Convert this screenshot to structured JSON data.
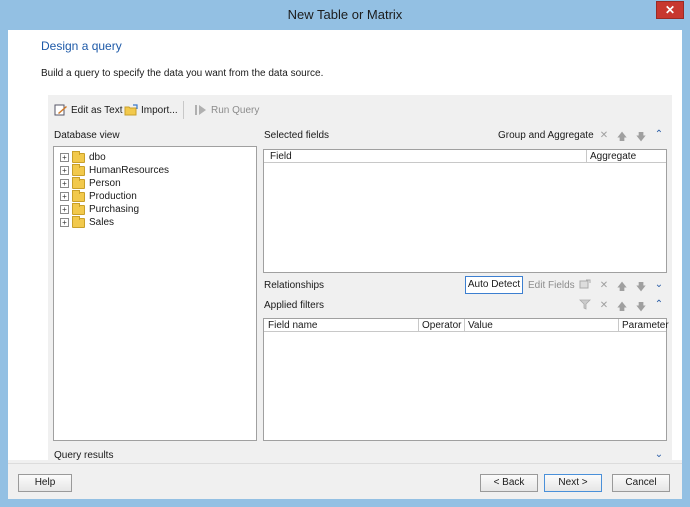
{
  "window": {
    "title": "New Table or Matrix",
    "close_glyph": "✕"
  },
  "page": {
    "title": "Design a query",
    "description": "Build a query to specify the data you want from the data source."
  },
  "toolbar": {
    "edit_as_text": "Edit as Text",
    "import": "Import...",
    "run_query": "Run Query"
  },
  "database_view": {
    "label": "Database view",
    "items": [
      {
        "label": "dbo"
      },
      {
        "label": "HumanResources"
      },
      {
        "label": "Person"
      },
      {
        "label": "Production"
      },
      {
        "label": "Purchasing"
      },
      {
        "label": "Sales"
      }
    ],
    "expander_glyph": "+"
  },
  "selected_fields": {
    "label": "Selected fields",
    "group_and_aggregate": "Group and Aggregate",
    "columns": [
      "Field",
      "Aggregate"
    ]
  },
  "relationships": {
    "label": "Relationships",
    "auto_detect": "Auto Detect",
    "edit_fields": "Edit Fields"
  },
  "applied_filters": {
    "label": "Applied filters",
    "columns": [
      "Field name",
      "Operator",
      "Value",
      "Parameter"
    ]
  },
  "query_results": {
    "label": "Query results"
  },
  "icons": {
    "delete": "✕",
    "move_up": "🡅",
    "move_down": "🡇",
    "collapse": "⌃",
    "expand": "⌄"
  },
  "footer": {
    "help": "Help",
    "back": "< Back",
    "next": "Next >",
    "cancel": "Cancel"
  },
  "colors": {
    "title_bar": "#93c0e3",
    "close_button": "#c7372f",
    "heading_blue": "#1e5aa8",
    "panel_bg": "#f0f0f0"
  }
}
